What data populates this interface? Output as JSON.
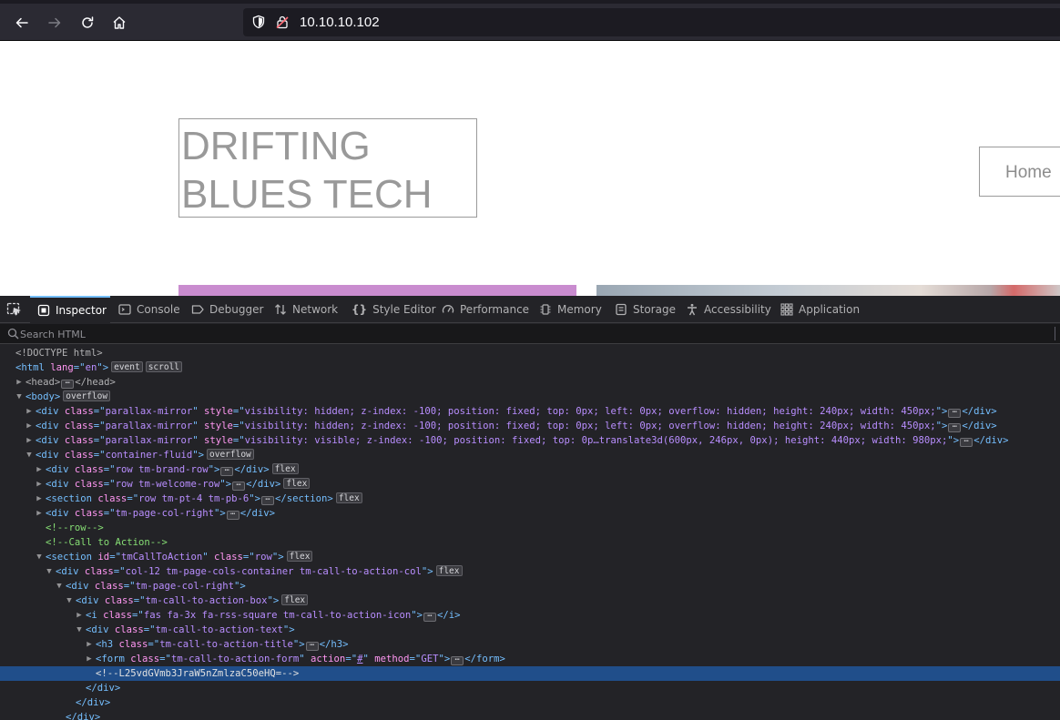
{
  "browser": {
    "url": "10.10.10.102"
  },
  "page": {
    "brand_line1": "DRIFTING",
    "brand_line2": "BLUES TECH",
    "nav_home": "Home"
  },
  "devtools": {
    "tabs": [
      {
        "label": "Inspector",
        "icon": "inspector-icon"
      },
      {
        "label": "Console",
        "icon": "console-icon"
      },
      {
        "label": "Debugger",
        "icon": "debugger-icon"
      },
      {
        "label": "Network",
        "icon": "network-icon"
      },
      {
        "label": "Style Editor",
        "icon": "style-editor-icon"
      },
      {
        "label": "Performance",
        "icon": "performance-icon"
      },
      {
        "label": "Memory",
        "icon": "memory-icon"
      },
      {
        "label": "Storage",
        "icon": "storage-icon"
      },
      {
        "label": "Accessibility",
        "icon": "accessibility-icon"
      },
      {
        "label": "Application",
        "icon": "application-icon"
      }
    ],
    "search_placeholder": "Search HTML",
    "tree": {
      "doctype": "<!DOCTYPE html>",
      "html_lang": "en",
      "badge_event": "event",
      "badge_scroll": "scroll",
      "badge_overflow": "overflow",
      "badge_flex": "flex",
      "pm_class": "parallax-mirror",
      "pm1_style": "visibility: hidden; z-index: -100; position: fixed; top: 0px; left: 0px; overflow: hidden; height: 240px; width: 450px;",
      "pm2_style": "visibility: hidden; z-index: -100; position: fixed; top: 0px; left: 0px; overflow: hidden; height: 240px; width: 450px;",
      "pm3_style": "visibility: visible; z-index: -100; position: fixed; top: 0p…translate3d(600px, 246px, 0px); height: 440px; width: 980px;",
      "container_class": "container-fluid",
      "brand_row_class": "row tm-brand-row",
      "welcome_row_class": "row tm-welcome-row",
      "section_class": "row tm-pt-4 tm-pb-6",
      "page_col_class": "tm-page-col-right",
      "comment_row": "<!--row-->",
      "comment_cta": "<!--Call to Action-->",
      "cta_id": "tmCallToAction",
      "cta_class": "row",
      "cols_class": "col-12 tm-page-cols-container tm-call-to-action-col",
      "box_class": "tm-call-to-action-box",
      "icon_class": "fas fa-3x fa-rss-square tm-call-to-action-icon",
      "text_class": "tm-call-to-action-text",
      "h3_class": "tm-call-to-action-title",
      "form_class": "tm-call-to-action-form",
      "form_action": "#",
      "form_method": "GET",
      "hidden_comment": "<!--L25vdGVmb3JraW5nZmlzaC50eHQ=-->"
    }
  }
}
